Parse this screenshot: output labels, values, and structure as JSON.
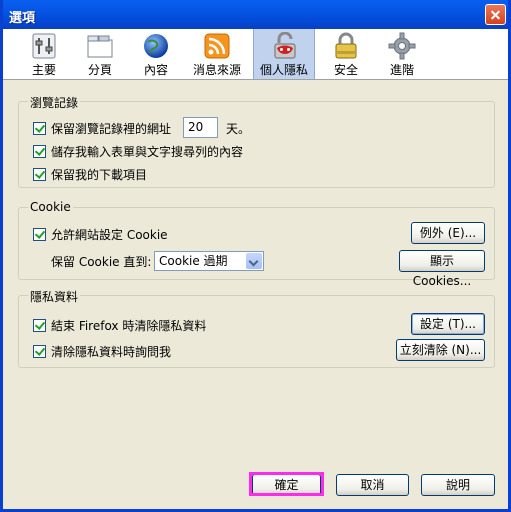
{
  "window": {
    "title": "選項"
  },
  "tabs": [
    {
      "label": "主要",
      "icon": "sliders-icon"
    },
    {
      "label": "分頁",
      "icon": "tabs-icon"
    },
    {
      "label": "內容",
      "icon": "globe-icon"
    },
    {
      "label": "消息來源",
      "icon": "rss-icon"
    },
    {
      "label": "個人隱私",
      "icon": "lock-mask-icon",
      "selected": true
    },
    {
      "label": "安全",
      "icon": "padlock-icon"
    },
    {
      "label": "進階",
      "icon": "gear-icon"
    }
  ],
  "history": {
    "title": "瀏覽記錄",
    "keep_history_label": "保留瀏覽記錄裡的網址",
    "days_value": "20",
    "days_unit": "天。",
    "save_forms_label": "儲存我輸入表單與文字搜尋列的內容",
    "keep_downloads_label": "保留我的下載項目"
  },
  "cookie": {
    "title": "Cookie",
    "accept_label": "允許網站設定 Cookie",
    "exceptions_button": "例外 (E)...",
    "keep_until_label": "保留 Cookie 直到:",
    "keep_until_value": "Cookie 過期",
    "show_cookies_button": "顯示 Cookies..."
  },
  "private_data": {
    "title": "隱私資料",
    "clear_on_exit_label": "結束 Firefox 時清除隱私資料",
    "settings_button": "設定 (T)...",
    "ask_before_label": "清除隱私資料時詢問我",
    "clear_now_button": "立刻清除 (N)..."
  },
  "footer": {
    "ok": "確定",
    "cancel": "取消",
    "help": "說明"
  },
  "colors": {
    "title_bar": "#0554e3",
    "highlight": "#ff2bea",
    "selected_tab": "#c1d2ee"
  }
}
